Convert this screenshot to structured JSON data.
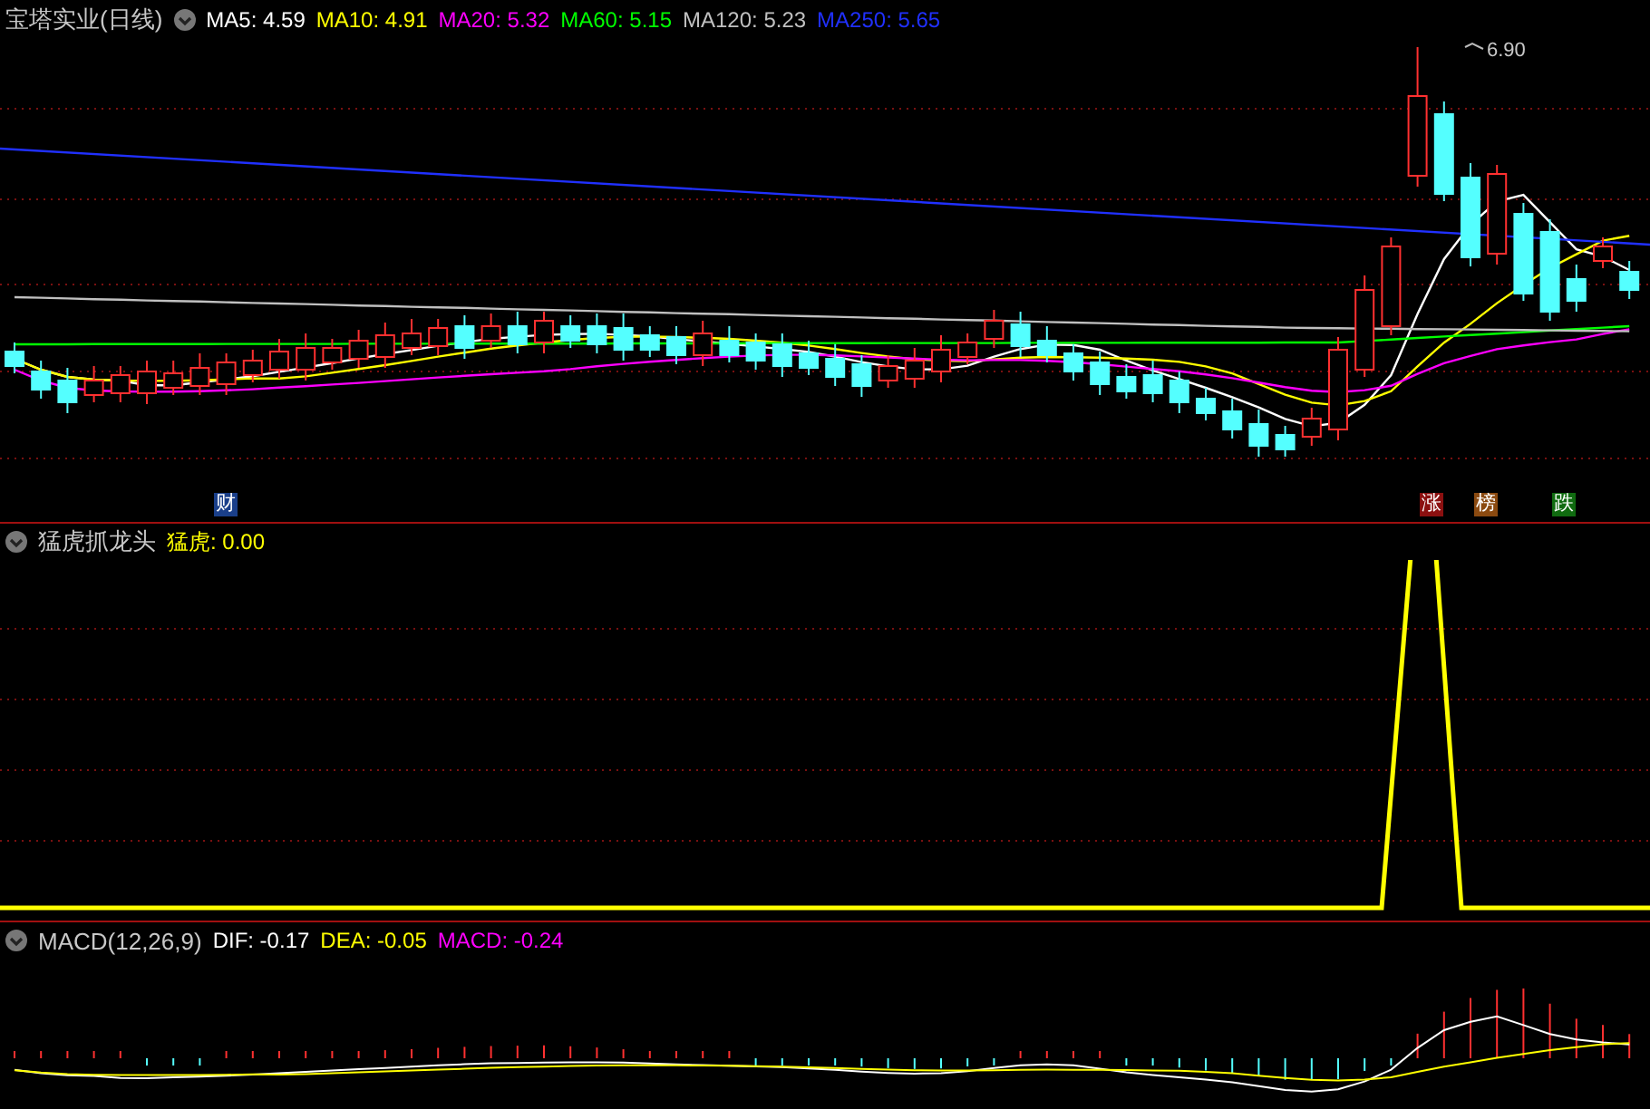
{
  "main_panel": {
    "title": "宝塔实业(日线)",
    "indicators": [
      {
        "label": "MA5: 4.59",
        "color": "#ffffff"
      },
      {
        "label": "MA10: 4.91",
        "color": "#ffff00"
      },
      {
        "label": "MA20: 5.32",
        "color": "#ff00ff"
      },
      {
        "label": "MA60: 5.15",
        "color": "#00ff00"
      },
      {
        "label": "MA120: 5.23",
        "color": "#c0c0c0"
      },
      {
        "label": "MA250: 5.65",
        "color": "#2030ff"
      }
    ],
    "high_label": "6.90",
    "event_tags": [
      {
        "label": "财",
        "color": "#1a3f8a"
      },
      {
        "label": "涨",
        "color": "#8b1010"
      },
      {
        "label": "榜",
        "color": "#8b4a10"
      },
      {
        "label": "跌",
        "color": "#106b10"
      }
    ]
  },
  "signal_panel": {
    "title": "猛虎抓龙头",
    "indicators": [
      {
        "label": "猛虎: 0.00",
        "color": "#ffff00"
      }
    ]
  },
  "macd_panel": {
    "title": "MACD(12,26,9)",
    "indicators": [
      {
        "label": "DIF: -0.17",
        "color": "#ffffff"
      },
      {
        "label": "DEA: -0.05",
        "color": "#ffff00"
      },
      {
        "label": "MACD: -0.24",
        "color": "#ff00ff"
      }
    ]
  }
}
